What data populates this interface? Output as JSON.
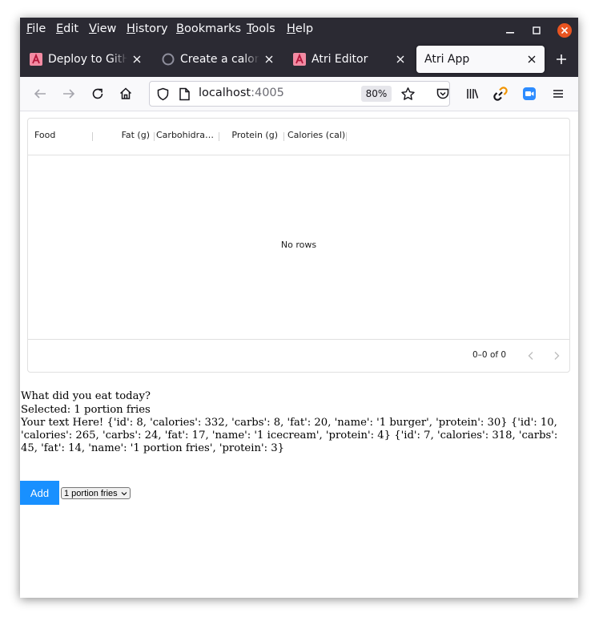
{
  "menubar": {
    "items": [
      "File",
      "Edit",
      "View",
      "History",
      "Bookmarks",
      "Tools",
      "Help"
    ]
  },
  "tabs": [
    {
      "label": "Deploy to GitHub",
      "icon": "atri-logo-icon",
      "active": false
    },
    {
      "label": "Create a calorie",
      "icon": "github-icon",
      "active": false
    },
    {
      "label": "Atri Editor",
      "icon": "atri-logo-icon",
      "active": false
    },
    {
      "label": "Atri App",
      "icon": "",
      "active": true
    }
  ],
  "navbar": {
    "url_host": "localhost",
    "url_port": ":4005",
    "zoom": "80%"
  },
  "grid": {
    "columns": [
      "Food",
      "Fat (g)",
      "Carbohidrates (g)",
      "Protein (g)",
      "Calories (cal)"
    ],
    "empty_text": "No rows",
    "pagination": "0–0 of 0"
  },
  "main": {
    "question": "What did you eat today?",
    "selected": "Selected: 1 portion fries",
    "dump": "Your text Here! {'id': 8, 'calories': 332, 'carbs': 8, 'fat': 20, 'name': '1 burger', 'protein': 30} {'id': 10, 'calories': 265, 'carbs': 24, 'fat': 17, 'name': '1 icecream', 'protein': 4} {'id': 7, 'calories': 318, 'carbs': 45, 'fat': 14, 'name': '1 portion fries', 'protein': 3}",
    "add_label": "Add",
    "select_value": "1 portion fries"
  },
  "colors": {
    "chrome_dark": "#2b2a33",
    "close_red": "#e95420",
    "add_button": "#1890ff"
  }
}
